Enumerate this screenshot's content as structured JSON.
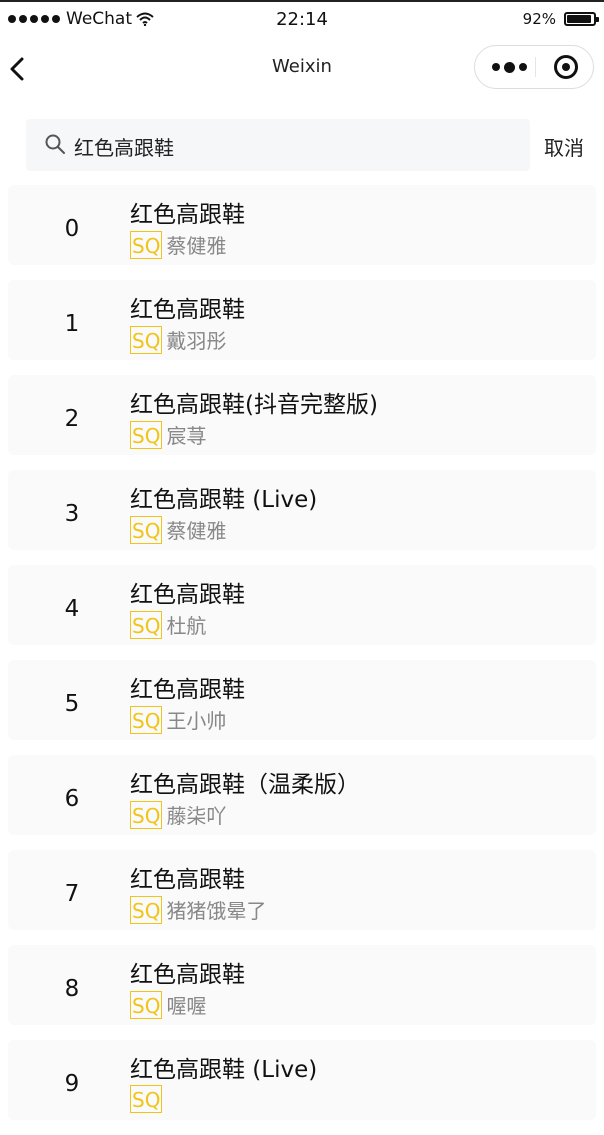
{
  "status_bar": {
    "carrier": "WeChat",
    "time": "22:14",
    "battery_label": "92%",
    "battery_level": 0.92
  },
  "nav": {
    "title": "Weixin"
  },
  "search": {
    "query": "红色高跟鞋",
    "cancel_label": "取消"
  },
  "badge_label": "SQ",
  "colors": {
    "badge": "#f0c419",
    "item_bg": "#fafafa",
    "search_bg": "#f6f7f9"
  },
  "results": [
    {
      "index": "0",
      "title": "红色高跟鞋",
      "artist": "蔡健雅"
    },
    {
      "index": "1",
      "title": "红色高跟鞋",
      "artist": "戴羽彤"
    },
    {
      "index": "2",
      "title": "红色高跟鞋(抖音完整版)",
      "artist": "宸荨"
    },
    {
      "index": "3",
      "title": "红色高跟鞋 (Live)",
      "artist": "蔡健雅"
    },
    {
      "index": "4",
      "title": "红色高跟鞋",
      "artist": "杜航"
    },
    {
      "index": "5",
      "title": "红色高跟鞋",
      "artist": "王小帅"
    },
    {
      "index": "6",
      "title": "红色高跟鞋（温柔版）",
      "artist": "藤柒吖"
    },
    {
      "index": "7",
      "title": "红色高跟鞋",
      "artist": "猪猪饿晕了"
    },
    {
      "index": "8",
      "title": "红色高跟鞋",
      "artist": "喔喔"
    },
    {
      "index": "9",
      "title": "红色高跟鞋 (Live)",
      "artist": ""
    }
  ]
}
